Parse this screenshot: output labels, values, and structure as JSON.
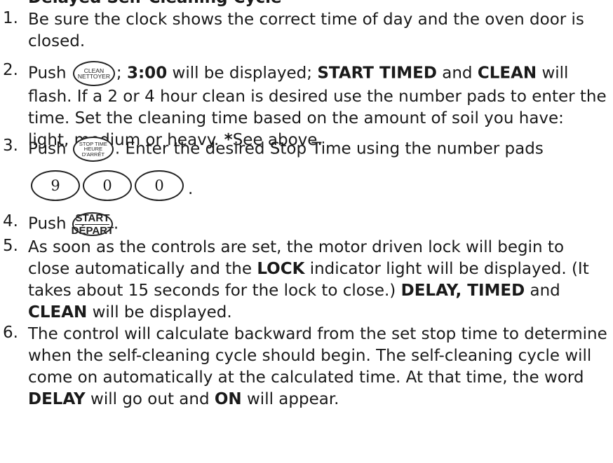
{
  "heading_fragment": "Delayed Self-Cleaning Cycle",
  "steps": [
    {
      "number": "1.",
      "text": "Be sure the clock shows the correct time of day and the oven door is closed."
    },
    {
      "number": "2.",
      "push": "Push",
      "after_key": ";",
      "bold1": "3:00",
      "t1": " will be displayed; ",
      "bold2": "START TIMED",
      "t2": " and ",
      "bold3": "CLEAN",
      "t3": " will flash.  If a 2 or 4 hour clean is desired use the number pads to enter the time.  Set the cleaning time based on the amount of soil you have: light, medium or heavy. ",
      "bold4": "*",
      "t4": "See above."
    },
    {
      "number": "3.",
      "push": "Push",
      "text": ".  Enter the desired Stop Time using the number pads"
    },
    {
      "number": "4.",
      "push": "Push",
      "text": "."
    },
    {
      "number": "5.",
      "t1": "As soon as the controls are set, the motor driven lock will begin to close automatically and the ",
      "bold1": "LOCK",
      "t2": " indicator light will be displayed. (It takes about 15 seconds for the lock to close.)  ",
      "bold2": "DELAY, TIMED",
      "t3": " and ",
      "bold3": "CLEAN",
      "t4": " will be displayed."
    },
    {
      "number": "6.",
      "t1": "The control will calculate backward from the set stop time to determine when the self-cleaning cycle should begin. The self-cleaning cycle will come on automatically at the calculated time. At that time, the word ",
      "bold1": "DELAY",
      "t2": " will go out and ",
      "bold2": "ON",
      "t3": " will appear."
    }
  ],
  "keys": {
    "clean": {
      "line1": "Clean",
      "line2": "Nettoyer"
    },
    "stop_time": {
      "line1": "Stop Time",
      "line2": "Heure",
      "line3": "d'Arrêt"
    },
    "start": {
      "line1": "START",
      "line2": "DÉPART"
    }
  },
  "number_pads": [
    "9",
    "0",
    "0"
  ],
  "number_pads_end": "."
}
